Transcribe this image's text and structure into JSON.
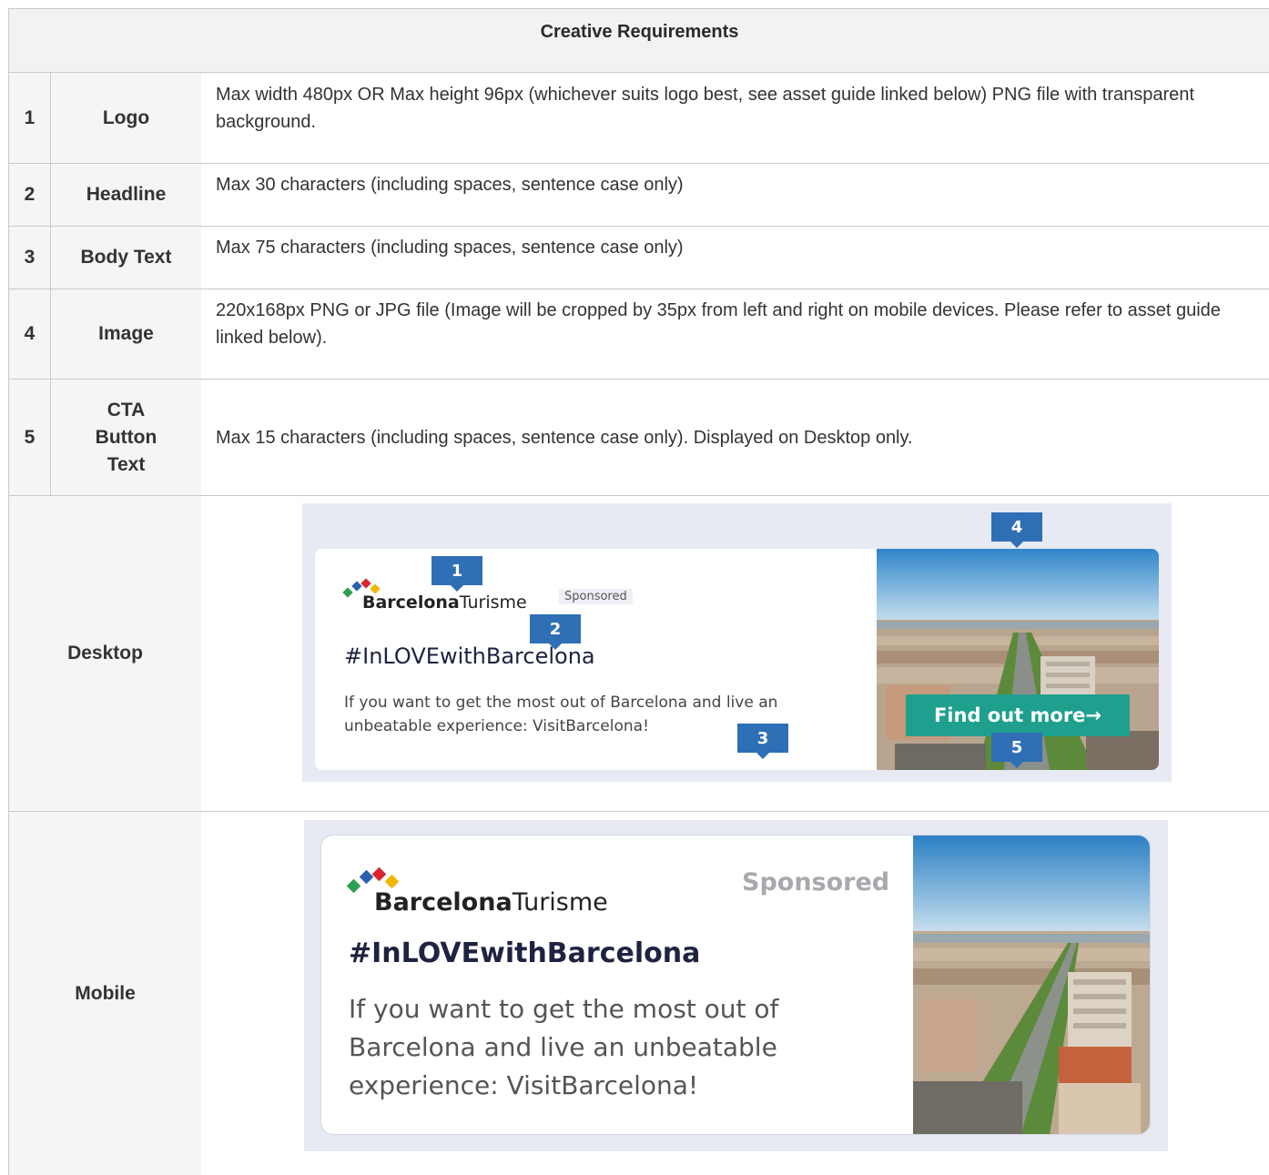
{
  "table_title": "Creative Requirements",
  "requirements": [
    {
      "num": "1",
      "label": "Logo",
      "desc": "Max width 480px OR Max height 96px (whichever suits logo best, see asset guide linked below) PNG file with transparent background."
    },
    {
      "num": "2",
      "label": "Headline",
      "desc": "Max 30 characters (including spaces, sentence case only)"
    },
    {
      "num": "3",
      "label": "Body Text",
      "desc": "Max 75 characters (including spaces, sentence case only)"
    },
    {
      "num": "4",
      "label": "Image",
      "desc": "220x168px PNG or JPG file (Image will be cropped by 35px from left and right on mobile devices. Please refer to asset guide linked below)."
    },
    {
      "num": "5",
      "label": "CTA Button Text",
      "desc": "Max 15 characters (including spaces, sentence case only). Displayed on Desktop only."
    }
  ],
  "desktop": {
    "label": "Desktop",
    "logo_bold": "Barcelona",
    "logo_light": "Turisme",
    "sponsored": "Sponsored",
    "headline": "#InLOVEwithBarcelona",
    "body": "If you want to get the most out of Barcelona and live an unbeatable experience: VisitBarcelona!",
    "cta": "Find out more→",
    "markers": [
      "1",
      "2",
      "3",
      "4",
      "5"
    ]
  },
  "mobile": {
    "label": "Mobile",
    "logo_bold": "Barcelona",
    "logo_light": "Turisme",
    "sponsored": "Sponsored",
    "headline": "#InLOVEwithBarcelona",
    "body": "If you want to get the most out of Barcelona and live an unbeatable experience: VisitBarcelona!"
  },
  "colors": {
    "marker": "#2e6fb5",
    "cta": "#1fa08e",
    "diamonds": [
      "#2e9e4f",
      "#2b5fb0",
      "#d8252e",
      "#f2b705"
    ]
  }
}
